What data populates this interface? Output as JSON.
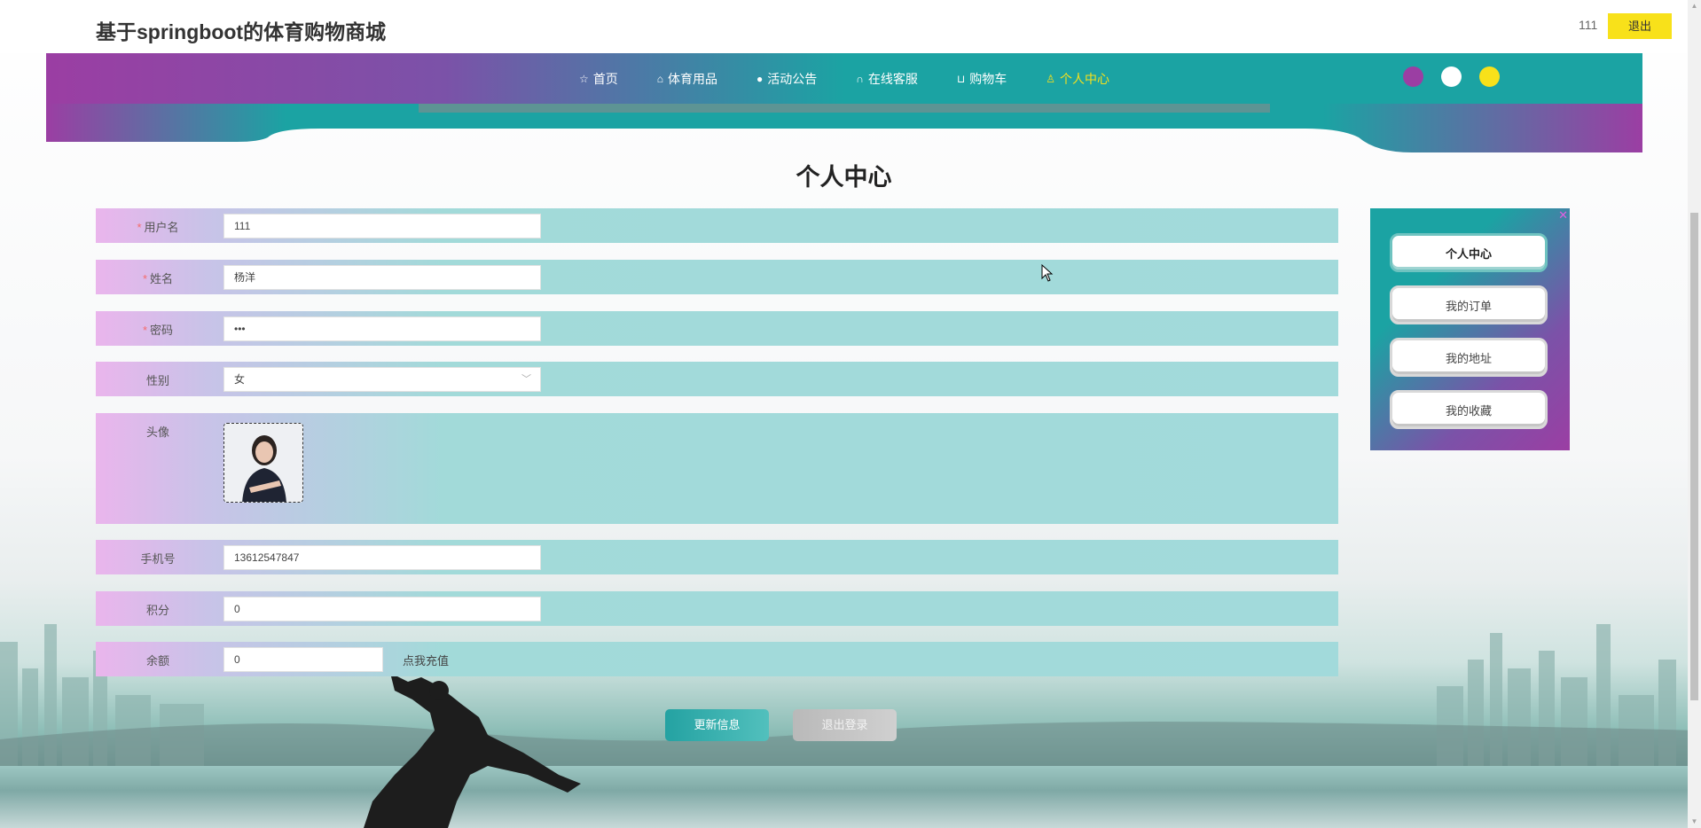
{
  "header": {
    "site_title": "基于springboot的体育购物商城",
    "user_name": "111",
    "logout_label": "退出"
  },
  "nav": {
    "items": [
      {
        "label": "首页",
        "icon": "star-icon"
      },
      {
        "label": "体育用品",
        "icon": "bag-icon"
      },
      {
        "label": "活动公告",
        "icon": "info-icon"
      },
      {
        "label": "在线客服",
        "icon": "headset-icon"
      },
      {
        "label": "购物车",
        "icon": "cart-icon"
      },
      {
        "label": "个人中心",
        "icon": "user-icon"
      }
    ],
    "active_index": 5,
    "theme_dots": [
      "#9b3ea3",
      "#ffffff",
      "#f8e11a"
    ]
  },
  "page_title": "个人中心",
  "form": {
    "username": {
      "label": "用户名",
      "value": "111",
      "required": true
    },
    "name": {
      "label": "姓名",
      "value": "杨洋",
      "required": true
    },
    "password": {
      "label": "密码",
      "value": "•••",
      "required": true
    },
    "gender": {
      "label": "性别",
      "value": "女"
    },
    "avatar": {
      "label": "头像"
    },
    "phone": {
      "label": "手机号",
      "value": "13612547847"
    },
    "points": {
      "label": "积分",
      "value": "0"
    },
    "balance": {
      "label": "余额",
      "value": "0",
      "recharge_label": "点我充值"
    }
  },
  "buttons": {
    "update": "更新信息",
    "logout": "退出登录"
  },
  "sidebar": {
    "close_glyph": "✕",
    "items": [
      {
        "label": "个人中心"
      },
      {
        "label": "我的订单"
      },
      {
        "label": "我的地址"
      },
      {
        "label": "我的收藏"
      }
    ]
  },
  "colors": {
    "accent_teal": "#1ba3a3",
    "accent_purple": "#9b3ea3",
    "accent_yellow": "#f8e11a"
  }
}
